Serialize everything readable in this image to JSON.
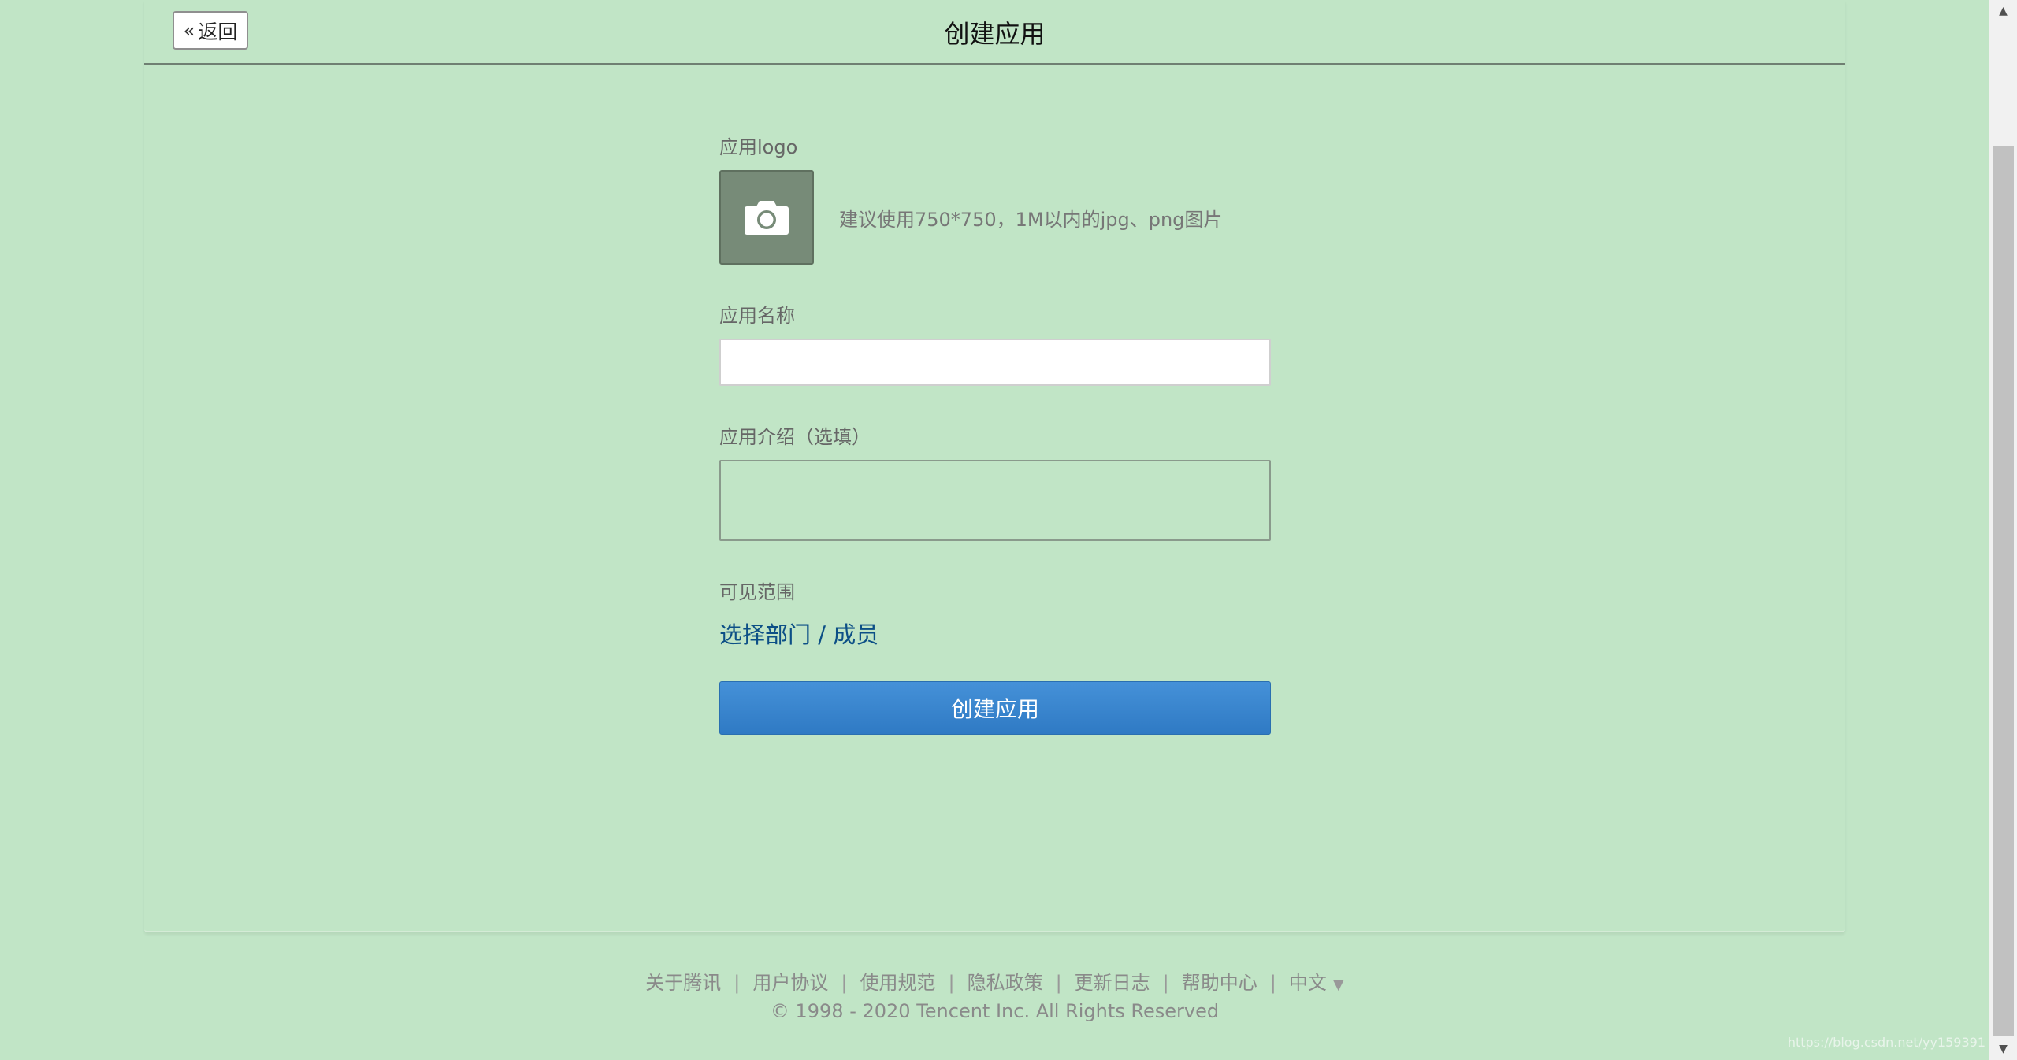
{
  "header": {
    "back_label": "返回",
    "title": "创建应用"
  },
  "form": {
    "logo_label": "应用logo",
    "logo_hint": "建议使用750*750，1M以内的jpg、png图片",
    "name_label": "应用名称",
    "name_value": "",
    "intro_label": "应用介绍（选填）",
    "intro_value": "",
    "scope_label": "可见范围",
    "scope_link": "选择部门 / 成员",
    "submit_label": "创建应用"
  },
  "icons": {
    "back": "chevron-double-left-icon",
    "logo_upload": "camera-icon",
    "language_dropdown": "caret-down-icon"
  },
  "colors": {
    "background": "#c1e5c6",
    "primary_button": "#3a86cf",
    "link": "#0c4f86",
    "logo_box": "#778b78"
  },
  "footer": {
    "links": [
      "关于腾讯",
      "用户协议",
      "使用规范",
      "隐私政策",
      "更新日志",
      "帮助中心"
    ],
    "language": "中文",
    "copyright": "© 1998 - 2020 Tencent Inc. All Rights Reserved"
  },
  "watermark": "https://blog.csdn.net/yy159391"
}
